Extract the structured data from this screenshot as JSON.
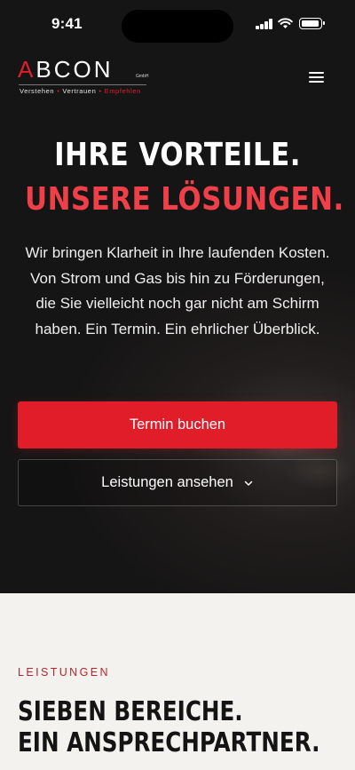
{
  "status_bar": {
    "time": "9:41",
    "signal_icon": "cellular-signal-icon",
    "wifi_icon": "wifi-icon",
    "battery_icon": "battery-icon"
  },
  "header": {
    "logo": {
      "word_parts": [
        "A",
        "B",
        "C",
        "O",
        "N"
      ],
      "gmbh": "GmbH",
      "tagline": [
        "Verstehen",
        "Vertrauen",
        "Empfehlen"
      ]
    },
    "menu_icon": "hamburger-menu-icon"
  },
  "hero": {
    "headline_line1": "IHRE VORTEILE.",
    "headline_line2": "UNSERE LÖSUNGEN.",
    "lead": "Wir bringen Klarheit in Ihre laufenden Kosten. Von Strom und Gas bis hin zu Förderungen, die Sie vielleicht noch gar nicht am Schirm haben. Ein Termin. Ein ehrlicher Überblick.",
    "primary_button": "Termin buchen",
    "secondary_button": "Leistungen ansehen",
    "secondary_icon": "chevron-down-icon"
  },
  "services_section": {
    "eyebrow": "LEISTUNGEN",
    "title_line1": "SIEBEN BEREICHE.",
    "title_line2": "EIN ANSPRECHPARTNER."
  },
  "colors": {
    "accent": "#e11d2a",
    "headline_red": "#ef3f49",
    "dark_bg": "#1a1818",
    "light_bg": "#f4f2ef"
  }
}
